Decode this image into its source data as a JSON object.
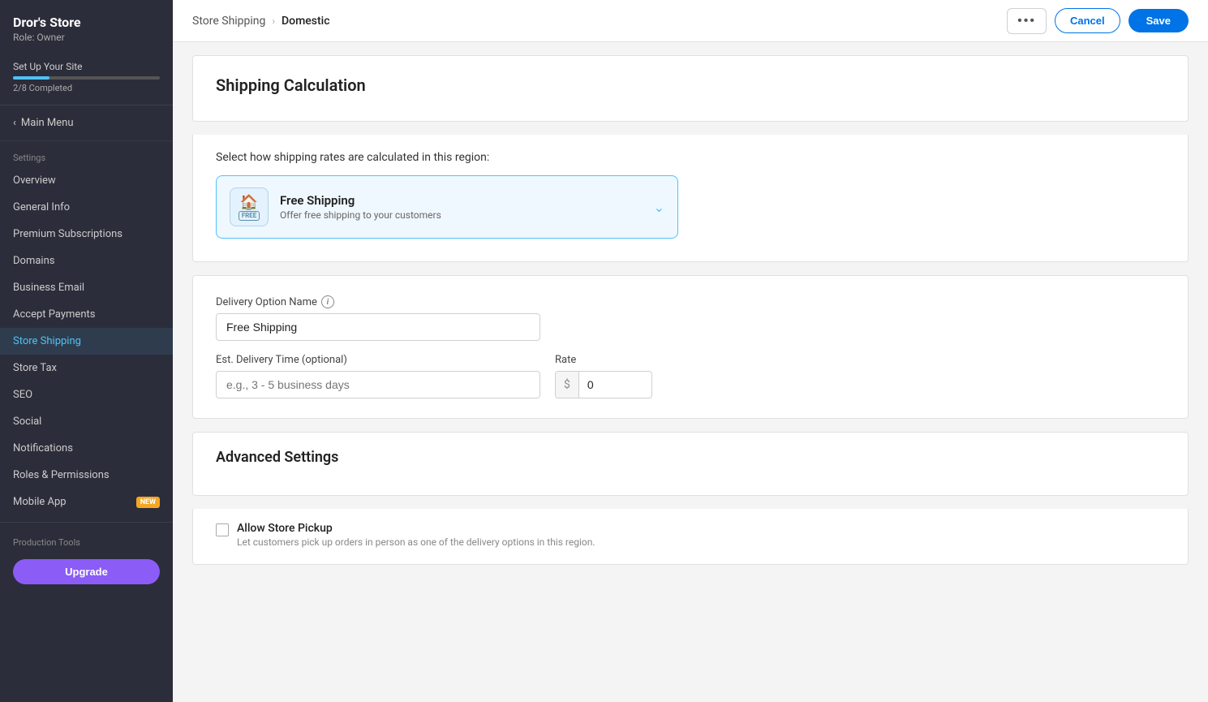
{
  "sidebar": {
    "store_name": "Dror's Store",
    "role": "Role: Owner",
    "setup": {
      "label": "Set Up Your Site",
      "progress_text": "2/8 Completed"
    },
    "main_menu_label": "Main Menu",
    "settings_label": "Settings",
    "nav_items": [
      {
        "id": "overview",
        "label": "Overview",
        "active": false
      },
      {
        "id": "general-info",
        "label": "General Info",
        "active": false
      },
      {
        "id": "premium-subscriptions",
        "label": "Premium Subscriptions",
        "active": false
      },
      {
        "id": "domains",
        "label": "Domains",
        "active": false
      },
      {
        "id": "business-email",
        "label": "Business Email",
        "active": false
      },
      {
        "id": "accept-payments",
        "label": "Accept Payments",
        "active": false
      },
      {
        "id": "store-shipping",
        "label": "Store Shipping",
        "active": true
      },
      {
        "id": "store-tax",
        "label": "Store Tax",
        "active": false
      },
      {
        "id": "seo",
        "label": "SEO",
        "active": false
      },
      {
        "id": "social",
        "label": "Social",
        "active": false
      },
      {
        "id": "notifications",
        "label": "Notifications",
        "active": false
      },
      {
        "id": "roles-permissions",
        "label": "Roles & Permissions",
        "active": false
      },
      {
        "id": "mobile-app",
        "label": "Mobile App",
        "active": false,
        "badge": "NEW"
      }
    ],
    "production_tools_label": "Production Tools",
    "upgrade_label": "Upgrade"
  },
  "topbar": {
    "breadcrumb_link": "Store Shipping",
    "breadcrumb_current": "Domestic",
    "more_label": "•••",
    "cancel_label": "Cancel",
    "save_label": "Save"
  },
  "shipping_calc": {
    "section_title": "Shipping Calculation",
    "select_label": "Select how shipping rates are calculated in this region:",
    "option_title": "Free Shipping",
    "option_desc": "Offer free shipping to your customers",
    "free_icon_text": "FREE"
  },
  "delivery_form": {
    "delivery_option_label": "Delivery Option Name",
    "delivery_option_value": "Free Shipping",
    "delivery_time_label": "Est. Delivery Time (optional)",
    "delivery_time_placeholder": "e.g., 3 - 5 business days",
    "rate_label": "Rate",
    "rate_prefix": "$",
    "rate_value": "0"
  },
  "advanced": {
    "section_title": "Advanced Settings",
    "allow_pickup_label": "Allow Store Pickup",
    "allow_pickup_desc": "Let customers pick up orders in person as one of the delivery options in this region."
  }
}
